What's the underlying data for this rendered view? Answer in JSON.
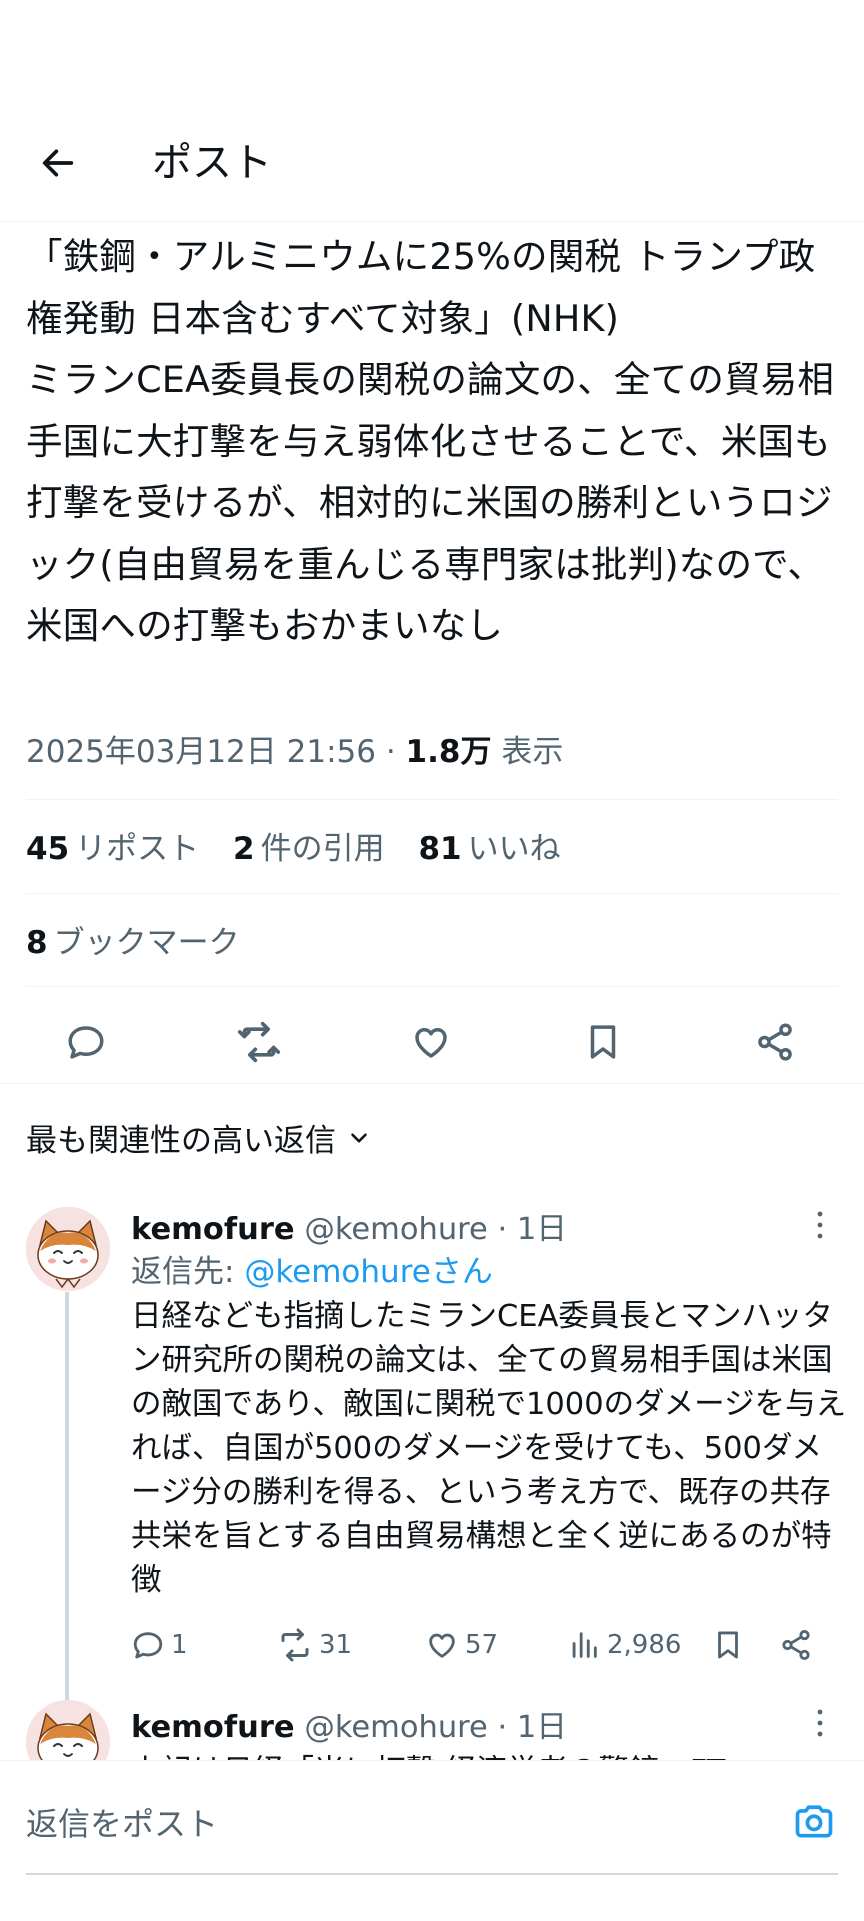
{
  "header": {
    "title": "ポスト"
  },
  "tweet": {
    "text": "「鉄鋼・アルミニウムに25%の関税 トランプ政権発動 日本含むすべて対象」(NHK)\nミランCEA委員長の関税の論文の、全ての貿易相手国に大打撃を与え弱体化させることで、米国も打撃を受けるが、相対的に米国の勝利というロジック(自由貿易を重んじる専門家は批判)なので、米国への打撃もおかまいなし",
    "timestamp": "2025年03月12日 21:56",
    "separator": " · ",
    "views_count": "1.8万",
    "views_label": " 表示",
    "reposts_count": "45",
    "reposts_label": "リポスト",
    "quotes_count": "2",
    "quotes_label": "件の引用",
    "likes_count": "81",
    "likes_label": "いいね",
    "bookmarks_count": "8",
    "bookmarks_label": "ブックマーク"
  },
  "sort": {
    "label": "最も関連性の高い返信"
  },
  "replies": [
    {
      "name": "kemofure",
      "handle": "@kemohure",
      "time": " · 1日",
      "reply_to_label": "返信先: ",
      "reply_to_handle": "@kemohureさん",
      "text": "日経なども指摘したミランCEA委員長とマンハッタン研究所の関税の論文は、全ての貿易相手国は米国の敵国であり、敵国に関税で1000のダメージを与えれば、自国が500のダメージを受けても、500ダメージ分の勝利を得る、という考え方で、既存の共存共栄を旨とする自由貿易構想と全く逆にあるのが特徴",
      "replies": "1",
      "reposts": "31",
      "likes": "57",
      "views": "2,986"
    },
    {
      "name": "kemofure",
      "handle": "@kemohure",
      "time": " · 1日",
      "text": "上記は日経「米に打撃 経済学者の警鐘」FT"
    }
  ],
  "compose": {
    "placeholder": "返信をポスト"
  },
  "colors": {
    "accent": "#1d9bf0",
    "text": "#0f1419",
    "secondary": "#536471",
    "border": "#eff3f4"
  },
  "icons": [
    "back-arrow-icon",
    "reply-icon",
    "repost-icon",
    "like-icon",
    "bookmark-icon",
    "share-icon",
    "chevron-down-icon",
    "more-icon",
    "views-icon",
    "camera-icon"
  ]
}
